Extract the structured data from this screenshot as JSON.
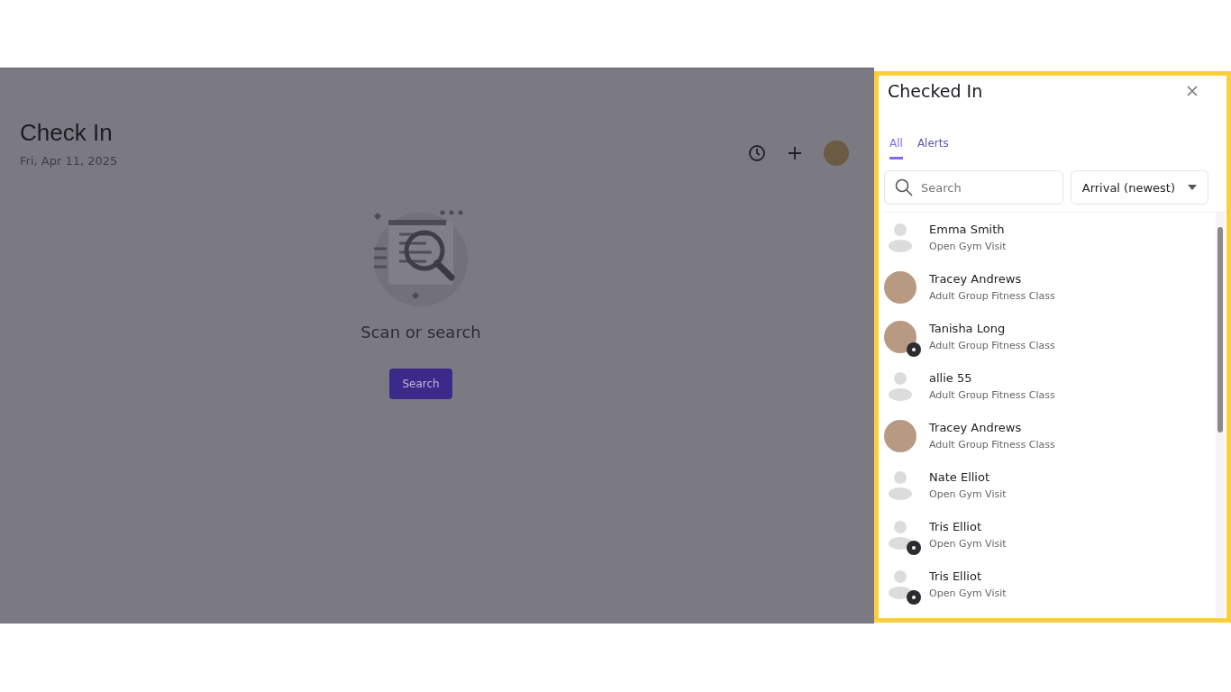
{
  "page": {
    "title": "Check In",
    "date": "Fri, Apr 11, 2025",
    "empty_state": {
      "message": "Scan or search",
      "button": "Search"
    }
  },
  "panel": {
    "title": "Checked In",
    "tabs": [
      {
        "label": "All",
        "selected": true
      },
      {
        "label": "Alerts",
        "selected": false
      }
    ],
    "search": {
      "placeholder": "Search"
    },
    "sort": {
      "value": "Arrival (newest)"
    },
    "people": [
      {
        "name": "Emma Smith",
        "visit": "Open Gym Visit",
        "kind": "placeholder",
        "badge": false
      },
      {
        "name": "Tracey Andrews",
        "visit": "Adult Group Fitness Class",
        "kind": "photo",
        "badge": false
      },
      {
        "name": "Tanisha Long",
        "visit": "Adult Group Fitness Class",
        "kind": "photo",
        "badge": true
      },
      {
        "name": "allie 55",
        "visit": "Adult Group Fitness Class",
        "kind": "placeholder",
        "badge": false
      },
      {
        "name": "Tracey Andrews",
        "visit": "Adult Group Fitness Class",
        "kind": "photo",
        "badge": false
      },
      {
        "name": "Nate Elliot",
        "visit": "Open Gym Visit",
        "kind": "placeholder",
        "badge": false
      },
      {
        "name": "Tris Elliot",
        "visit": "Open Gym Visit",
        "kind": "placeholder",
        "badge": true
      },
      {
        "name": "Tris Elliot",
        "visit": "Open Gym Visit",
        "kind": "placeholder",
        "badge": true
      }
    ]
  }
}
